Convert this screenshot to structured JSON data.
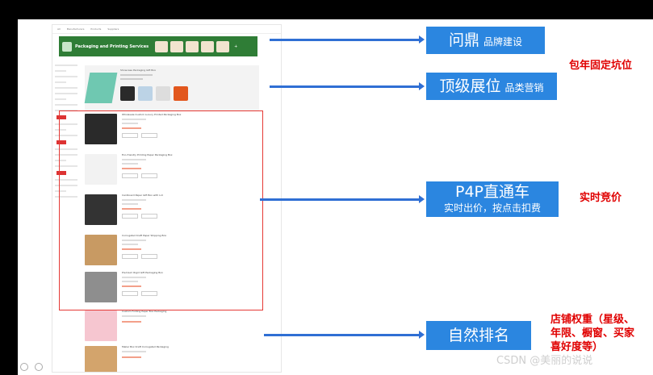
{
  "screenshot": {
    "banner_title": "Packaging and Printing Services",
    "nav_items": [
      "All",
      "Manufacturers",
      "Products",
      "Suppliers"
    ],
    "promo_title": "Showcase Packaging Gift Box",
    "items": [
      {
        "title": "Wholesale Custom Luxury Printed Packaging Box"
      },
      {
        "title": "Eco-friendly Printing Paper Packaging Box"
      },
      {
        "title": "Cardboard Paper Gift Box with Lid"
      },
      {
        "title": "Corrugated Kraft Paper Shipping Box"
      },
      {
        "title": "Premium Rigid Gift Packaging Box"
      }
    ],
    "natural_items": [
      {
        "title": "Custom Folding Paper Box Packaging"
      },
      {
        "title": "Mailer Box Kraft Corrugated Packaging"
      }
    ]
  },
  "labels": {
    "box1_main": "问鼎",
    "box1_sub": "品牌建设",
    "box2_main": "顶级展位",
    "box2_sub": "品类营销",
    "box3_main": "P4P直通车",
    "box3_sub": "实时出价，按点击扣费",
    "box4_main": "自然排名",
    "note1": "包年固定坑位",
    "note2": "实时竞价",
    "note3": "店铺权重（星级、\n年限、橱窗、买家\n喜好度等）"
  },
  "watermark": "CSDN @美丽的说说",
  "colors": {
    "accent_blue": "#2b86e0",
    "arrow_blue": "#2f6fd4",
    "red": "#e00000",
    "sponsor_border": "#e53935"
  }
}
